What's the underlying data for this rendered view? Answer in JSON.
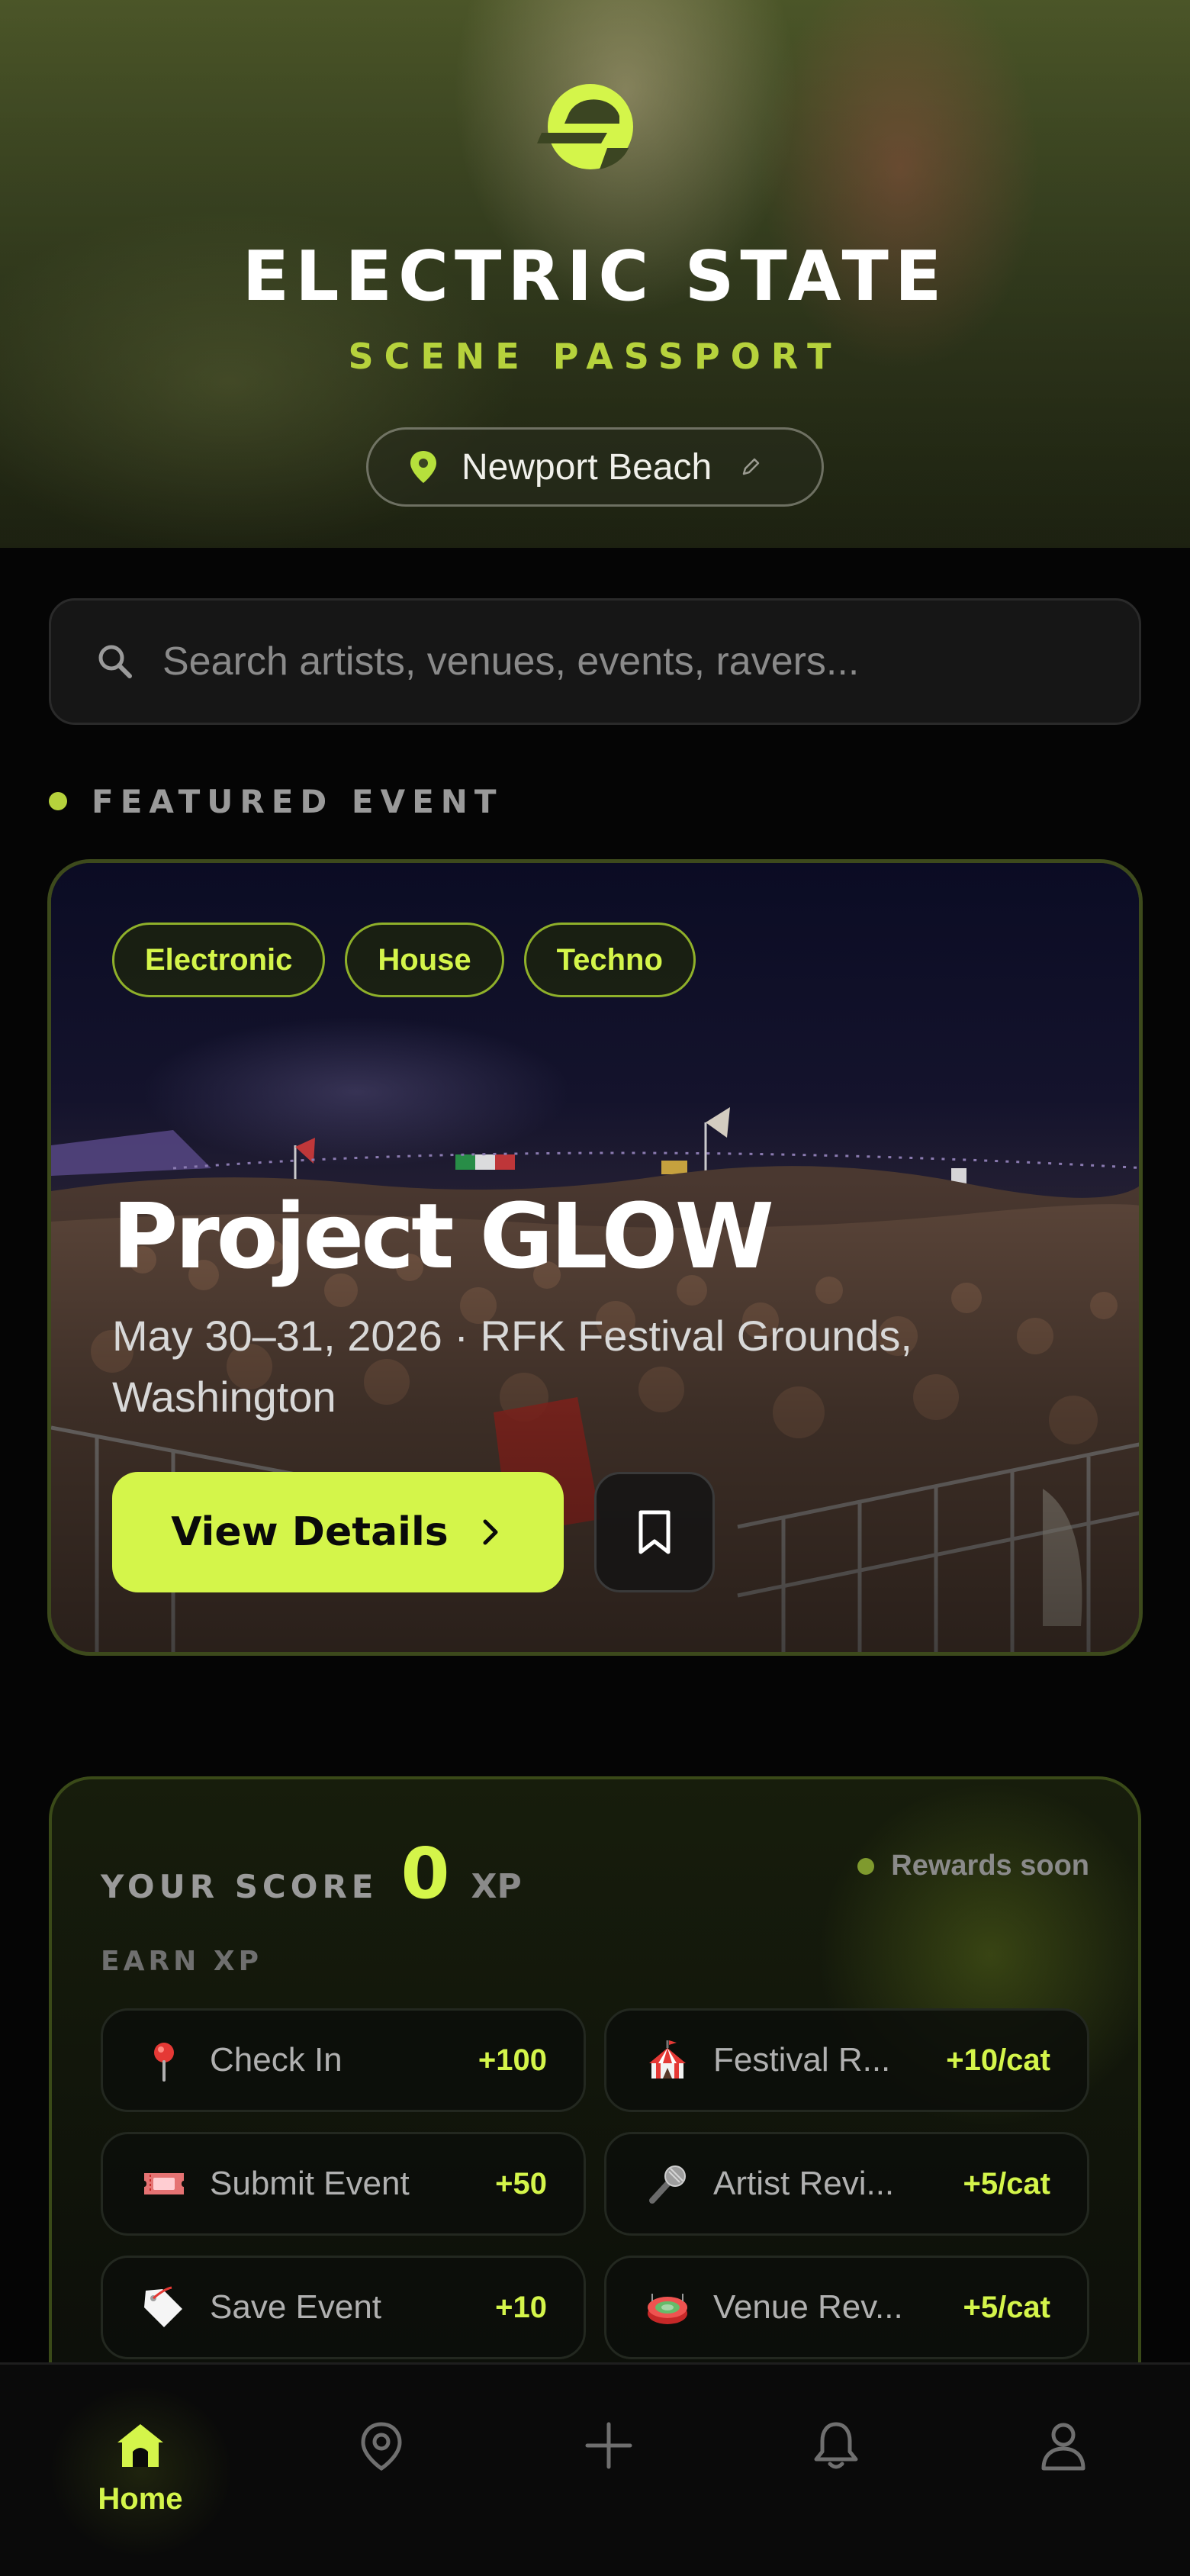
{
  "brand": {
    "title": "ELECTRIC STATE",
    "subtitle": "SCENE PASSPORT",
    "accent_color": "#d4f54a"
  },
  "location": {
    "label": "Newport Beach",
    "icon": "map-pin-icon",
    "edit_icon": "pencil-icon"
  },
  "search": {
    "placeholder": "Search artists, venues, events, ravers..."
  },
  "featured": {
    "section_label": "FEATURED EVENT",
    "tags": [
      "Electronic",
      "House",
      "Techno"
    ],
    "title": "Project GLOW",
    "meta": "May 30–31, 2026  ·  RFK Festival Grounds, Washington",
    "view_details_label": "View Details",
    "bookmark_icon": "bookmark-icon"
  },
  "score": {
    "label": "YOUR SCORE",
    "value": "0",
    "unit": "XP",
    "rewards_status": "Rewards soon",
    "earn_label": "EARN XP",
    "items": [
      {
        "icon": "pin-emoji",
        "name": "Check In",
        "points": "+100"
      },
      {
        "icon": "circus-tent-emoji",
        "name": "Festival R...",
        "points": "+10/cat"
      },
      {
        "icon": "ticket-emoji",
        "name": "Submit Event",
        "points": "+50"
      },
      {
        "icon": "microphone-emoji",
        "name": "Artist Revi...",
        "points": "+5/cat"
      },
      {
        "icon": "bookmark-tag-emoji",
        "name": "Save Event",
        "points": "+10"
      },
      {
        "icon": "stadium-emoji",
        "name": "Venue Rev...",
        "points": "+5/cat"
      }
    ]
  },
  "nav": {
    "home_label": "Home",
    "items": [
      "home-icon",
      "map-icon",
      "add-icon",
      "bell-icon",
      "profile-icon"
    ]
  }
}
